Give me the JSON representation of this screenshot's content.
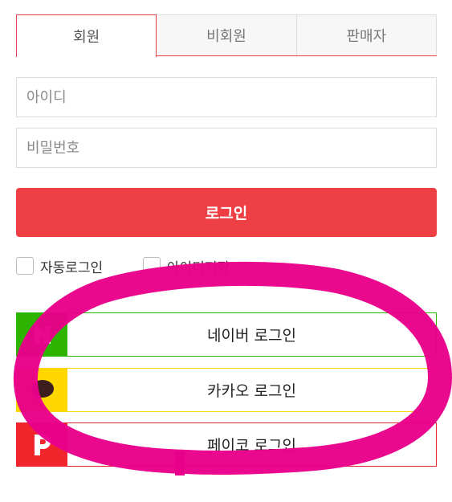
{
  "tabs": [
    {
      "label": "회원",
      "active": true
    },
    {
      "label": "비회원",
      "active": false
    },
    {
      "label": "판매자",
      "active": false
    }
  ],
  "form": {
    "id_placeholder": "아이디",
    "password_placeholder": "비밀번호",
    "login_label": "로그인"
  },
  "options": {
    "auto_login_label": "자동로그인",
    "save_id_label": "아이디저장"
  },
  "social": {
    "naver": {
      "label": "네이버 로그인",
      "icon": "naver-n-icon",
      "color": "#2db400"
    },
    "kakao": {
      "label": "카카오 로그인",
      "icon": "kakao-speech-bubble-icon",
      "color": "#ffd700"
    },
    "payco": {
      "label": "페이코 로그인",
      "icon": "payco-p-icon",
      "color": "#f1252b"
    }
  },
  "colors": {
    "accent": "#ee3f45",
    "annotation": "#e8008a"
  }
}
